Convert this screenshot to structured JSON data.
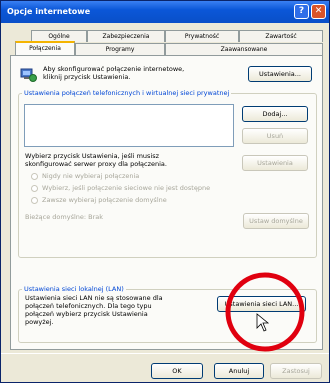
{
  "window": {
    "title": "Opcje internetowe",
    "help_glyph": "?",
    "close_glyph": "✕"
  },
  "tabs_row1": [
    "Ogólne",
    "Zabezpieczenia",
    "Prywatność",
    "Zawartość"
  ],
  "tabs_row2": [
    "Połączenia",
    "Programy",
    "Zaawansowane"
  ],
  "setup": {
    "text": "Aby skonfigurować połączenie internetowe, kliknij przycisk Ustawienia.",
    "button": "Ustawienia..."
  },
  "dialup_group": {
    "label": "Ustawienia połączeń telefonicznych i wirtualnej sieci prywatnej",
    "add_button": "Dodaj...",
    "remove_button": "Usuń",
    "settings_button": "Ustawienia",
    "proxy_text": "Wybierz przycisk Ustawienia, jeśli musisz skonfigurować serwer proxy dla połączenia.",
    "radio1": "Nigdy nie wybieraj połączenia",
    "radio2": "Wybierz, jeśli połączenie sieciowe nie jest dostępne",
    "radio3": "Zawsze wybieraj połączenie domyślne",
    "current_default": "Bieżące domyślne:  Brak",
    "default_button": "Ustaw domyślne"
  },
  "lan_group": {
    "label": "Ustawienia sieci lokalnej (LAN)",
    "text": "Ustawienia sieci LAN nie są stosowane dla połączeń telefonicznych. Dla tego typu połączeń wybierz przycisk Ustawienia powyżej.",
    "button": "Ustawienia sieci LAN..."
  },
  "footer": {
    "ok": "OK",
    "cancel": "Anuluj",
    "apply": "Zastosuj"
  },
  "colors": {
    "titlebar": "#0b57d8",
    "highlight_circle": "#e0000f",
    "group_label": "#0046d5"
  }
}
